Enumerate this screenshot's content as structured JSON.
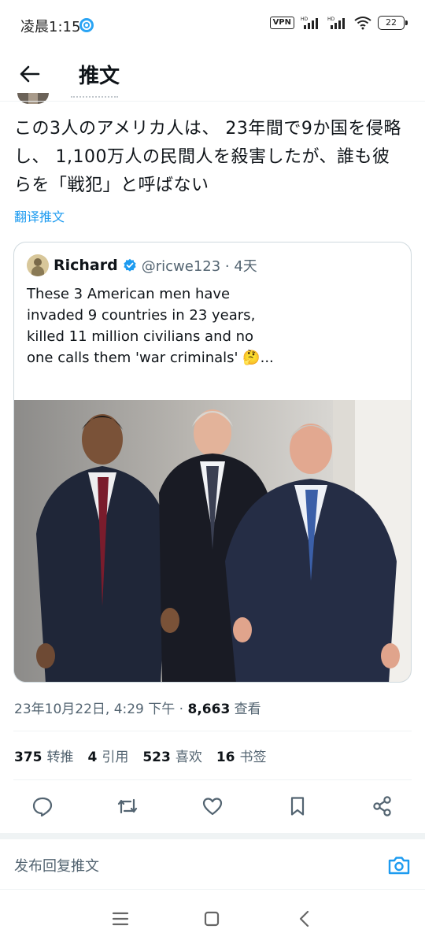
{
  "status_bar": {
    "time": "凌晨1:15",
    "vpn": "VPN",
    "battery": "22",
    "icons": [
      "app-status-icon",
      "signal-icon",
      "signal-icon",
      "wifi-icon",
      "battery-icon"
    ]
  },
  "header": {
    "back_icon": "arrow-left-icon",
    "title": "推文"
  },
  "tweet": {
    "text": "この3人のアメリカ人は、 23年間で9か国を侵略し、 1,100万人の民間人を殺害したが、誰も彼らを「戦犯」と呼ばない",
    "translate_label": "翻译推文"
  },
  "quote": {
    "name": "Richard",
    "handle_line": "@ricwe123 · 4天",
    "text": "These 3 American men have invaded 9 countries in 23 years, killed 11 million civilians and no one calls them 'war criminals' 🤔...",
    "verified_icon": "verified-badge-icon"
  },
  "meta": {
    "timestamp": "23年10月22日, 4:29 下午 · ",
    "views_count": "8,663",
    "views_label": " 查看"
  },
  "stats": {
    "retweets_count": "375",
    "retweets_label": "转推",
    "quotes_count": "4",
    "quotes_label": "引用",
    "likes_count": "523",
    "likes_label": "喜欢",
    "bookmarks_count": "16",
    "bookmarks_label": "书签"
  },
  "actions": [
    "reply-icon",
    "retweet-icon",
    "like-icon",
    "bookmark-icon",
    "share-icon"
  ],
  "reply": {
    "placeholder": "发布回复推文",
    "camera_icon": "camera-icon"
  },
  "nav": [
    "menu-icon",
    "home-icon",
    "back-icon"
  ],
  "colors": {
    "accent": "#1d9bf0",
    "text": "#0f1419",
    "secondary": "#536471",
    "border": "#cfd9de"
  }
}
